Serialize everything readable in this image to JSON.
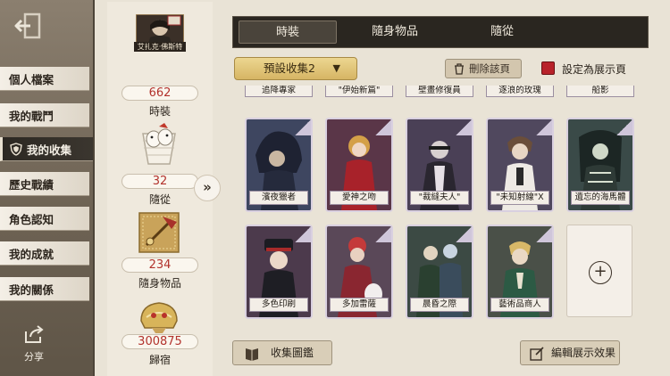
{
  "sidebar": {
    "items": [
      {
        "label": "個人檔案"
      },
      {
        "label": "我的戰鬥"
      },
      {
        "label": "我的收集"
      },
      {
        "label": "歷史戰績"
      },
      {
        "label": "角色認知"
      },
      {
        "label": "我的成就"
      },
      {
        "label": "我的關係"
      }
    ],
    "active_index": 2,
    "share_label": "分享"
  },
  "profile": {
    "character_name": "艾扎克·佛斯特"
  },
  "stats": [
    {
      "value": "662",
      "label": "時裝"
    },
    {
      "value": "32",
      "label": "隨從"
    },
    {
      "value": "234",
      "label": "隨身物品"
    },
    {
      "value": "300875",
      "label": "歸宿"
    }
  ],
  "tabs": [
    {
      "label": "時裝"
    },
    {
      "label": "隨身物品"
    },
    {
      "label": "隨從"
    }
  ],
  "active_tab": 0,
  "toolbar": {
    "preset_label": "預設收集2",
    "delete_label": "刪除該頁",
    "showcase_label": "設定為展示頁"
  },
  "partial_row": [
    "追降專家",
    "\"伊始新篇\"",
    "壁畫修復員",
    "逐浪的玫瑰",
    "船影"
  ],
  "cards": [
    {
      "name": "濱夜獵者"
    },
    {
      "name": "愛神之吻"
    },
    {
      "name": "\"裁縫夫人\""
    },
    {
      "name": "\"未知射線\"X"
    },
    {
      "name": "遺忘的海馬體"
    },
    {
      "name": "多色印刷"
    },
    {
      "name": "多加雷薩"
    },
    {
      "name": "晨昏之際"
    },
    {
      "name": "藝術品商人"
    }
  ],
  "bottom": {
    "gallery_label": "收集圖鑑",
    "edit_label": "編輯展示效果"
  },
  "colors": {
    "accent_red": "#b2322c",
    "gold": "#d6b564",
    "card_frame": "#5a4e64"
  }
}
